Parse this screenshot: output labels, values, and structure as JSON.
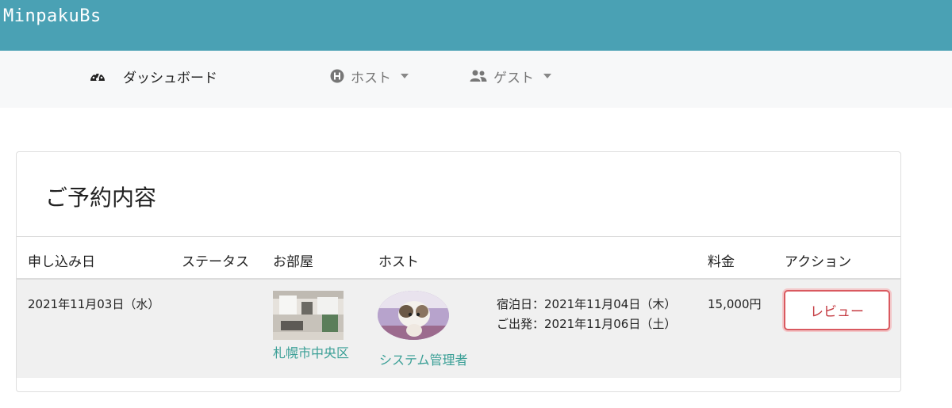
{
  "app": {
    "brand": "MinpakuBs",
    "brand_color": "#4aa1b4"
  },
  "nav": {
    "dashboard": {
      "label": "ダッシュボード",
      "icon": "speedometer-icon"
    },
    "host": {
      "label": "ホスト",
      "icon": "h-circle-icon"
    },
    "guest": {
      "label": "ゲスト",
      "icon": "users-icon"
    }
  },
  "reservation": {
    "title": "ご予約内容",
    "columns": [
      "申し込み日",
      "ステータス",
      "お部屋",
      "ホスト",
      "料金",
      "アクション"
    ],
    "row": {
      "applied_date": "2021年11月03日（水）",
      "status": "",
      "room_name": "札幌市中央区",
      "host_name": "システム管理者",
      "checkin": "宿泊日：2021年11月04日（木）",
      "checkout": "ご出発：2021年11月06日（土）",
      "price": "15,000円",
      "action_label": "レビュー"
    }
  },
  "colors": {
    "link": "#3a9f96",
    "review_button": "#d9595f"
  }
}
